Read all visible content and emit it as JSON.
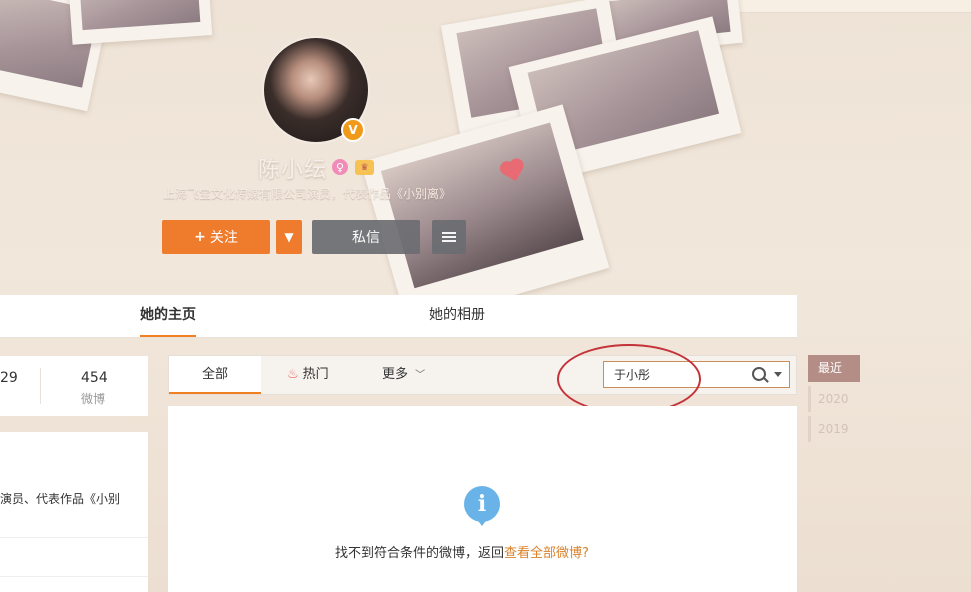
{
  "profile": {
    "name": "陈小纭",
    "verified_badge": "V",
    "description": "上海飞宝文化传媒有限公司演员，代表作品《小别离》",
    "follow_label": "关注",
    "message_label": "私信"
  },
  "tabs": {
    "home": "她的主页",
    "album": "她的相册"
  },
  "stats": {
    "first_num": "29",
    "second_num": "454",
    "second_label": "微博"
  },
  "info": {
    "text": "演员、代表作品《小别"
  },
  "filter": {
    "all": "全部",
    "hot": "热门",
    "more": "更多"
  },
  "search": {
    "value": "于小彤"
  },
  "timeline": {
    "recent": "最近",
    "years": [
      "2020",
      "2019"
    ]
  },
  "empty": {
    "message": "找不到符合条件的微博，返回",
    "link": "查看全部微博?"
  },
  "colors": {
    "accent": "#ef7b2c",
    "annotation": "#c4323a",
    "link": "#d9822b"
  },
  "icons": [
    "gender-female-icon",
    "vip-icon",
    "menu-icon",
    "flame-icon",
    "chevron-down-icon",
    "search-icon",
    "info-icon"
  ]
}
